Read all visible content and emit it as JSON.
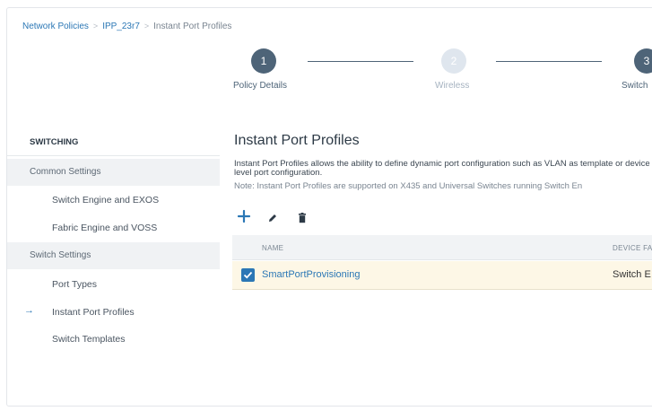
{
  "breadcrumb": {
    "items": [
      "Network Policies",
      "IPP_23r7",
      "Instant Port Profiles"
    ]
  },
  "stepper": {
    "steps": [
      {
        "number": "1",
        "label": "Policy Details",
        "state": "active"
      },
      {
        "number": "2",
        "label": "Wireless",
        "state": "inactive"
      },
      {
        "number": "3",
        "label": "Switch",
        "state": "active"
      }
    ]
  },
  "sidebar": {
    "heading": "SWITCHING",
    "common_settings": "Common Settings",
    "switch_engine": "Switch Engine and EXOS",
    "fabric_engine": "Fabric Engine and VOSS",
    "switch_settings": "Switch Settings",
    "port_types": "Port Types",
    "instant_port_profiles": "Instant Port Profiles",
    "switch_templates": "Switch Templates",
    "selected_icon": "arrow-right-icon"
  },
  "main": {
    "title": "Instant Port Profiles",
    "description": "Instant Port Profiles allows the ability to define dynamic port configuration such as VLAN as template or device level port configuration.",
    "note": "Note: Instant Port Profiles are supported on X435 and Universal Switches running Switch En",
    "toolbar": {
      "add_icon": "plus-icon",
      "edit_icon": "pencil-icon",
      "delete_icon": "trash-icon"
    },
    "table": {
      "columns": [
        "NAME",
        "DEVICE FA"
      ],
      "rows": [
        {
          "name": "SmartPortProvisioning",
          "device_family": "Switch E",
          "checked": true
        }
      ]
    }
  },
  "colors": {
    "accent": "#2b77b5",
    "step_active": "#4e6478",
    "row_selected": "#fdf7e6"
  }
}
